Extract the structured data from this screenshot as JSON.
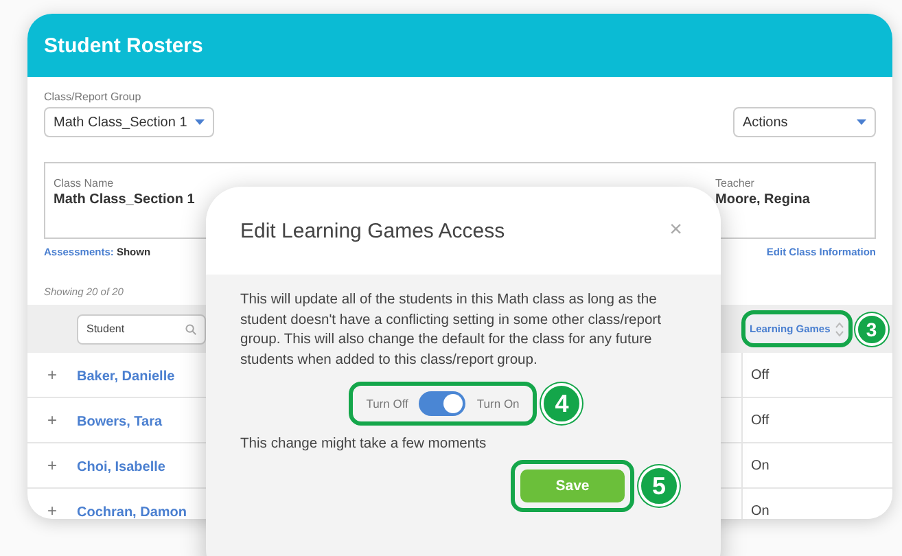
{
  "header": {
    "title": "Student Rosters"
  },
  "group_select": {
    "label": "Class/Report Group",
    "value": "Math Class_Section 1"
  },
  "actions_select": {
    "value": "Actions"
  },
  "class_info": [
    {
      "label": "Class Name",
      "value": "Math Class_Section 1"
    },
    {
      "label": "Teacher",
      "value": "Moore, Regina"
    }
  ],
  "assessments": {
    "label": "Assessments:",
    "value": "Shown"
  },
  "edit_link": "Edit Class Information",
  "count": "Showing 20 of 20",
  "table": {
    "search_placeholder": "Student",
    "column_header": "Learning Games",
    "rows": [
      {
        "expand": "+",
        "name": "Baker, Danielle",
        "learning_games": "Off"
      },
      {
        "expand": "+",
        "name": "Bowers, Tara",
        "learning_games": "Off"
      },
      {
        "expand": "+",
        "name": "Choi, Isabelle",
        "learning_games": "On"
      },
      {
        "expand": "+",
        "name": "Cochran, Damon",
        "learning_games": "On"
      }
    ]
  },
  "dialog": {
    "title": "Edit Learning Games Access",
    "close": "×",
    "message": "This will update all of the students in this Math class as long as the student doesn't have a conflicting setting in some other class/report group. This will also change the default for the class for any future students when added to this class/report group.",
    "toggle": {
      "off_label": "Turn Off",
      "on_label": "Turn On",
      "on": true
    },
    "note": "This change might take a few moments",
    "save": "Save"
  },
  "callouts": [
    {
      "number": "3"
    },
    {
      "number": "4"
    },
    {
      "number": "5"
    }
  ]
}
